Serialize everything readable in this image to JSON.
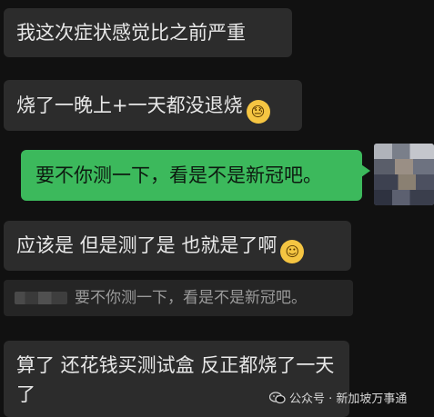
{
  "messages": [
    {
      "text": "我这次症状感觉比之前严重"
    },
    {
      "text": "烧了一晚上+一天都没退烧"
    },
    {
      "text": "要不你测一下，看是不是新冠吧。"
    },
    {
      "text": "应该是 但是测了是 也就是了啊"
    },
    {
      "text": "算了 还花钱买测试盒 反正都烧了一天了"
    }
  ],
  "quote": {
    "text": "要不你测一下，看是不是新冠吧。"
  },
  "watermark": {
    "text": "公众号 · 新加坡万事通"
  },
  "icons": {
    "sweat": "sweating-face-emoji",
    "smile": "smiling-face-emoji",
    "wechat": "wechat-icon"
  },
  "colors": {
    "background": "#111111",
    "received": "#2c2c2c",
    "sent": "#3cb95c"
  }
}
